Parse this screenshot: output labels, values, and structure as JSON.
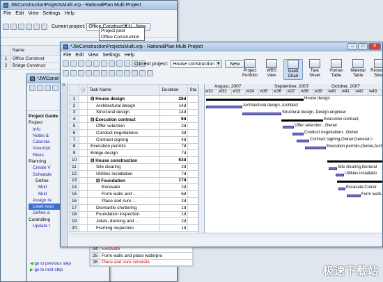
{
  "back_window": {
    "title": "JWConstructionProjectsMulti.xrp - RationalPlan Multi Project",
    "menu": [
      "File",
      "Edit",
      "View",
      "Settings",
      "Help"
    ],
    "current_project_label": "Current project:",
    "current_project_value": "Office Construction",
    "dropdown_options": [
      "Project pool",
      "Office Construction"
    ],
    "new_button": "New",
    "view_buttons": [
      "Project Portfolio",
      "WBS View",
      "Gantt Chart",
      "Task Sheet",
      "Human Table",
      "Material Table",
      "Resource Sheet"
    ],
    "name_header": "Name",
    "rows": [
      {
        "n": "1",
        "name": "Office Construct"
      },
      {
        "n": "2",
        "name": "Bridge Construct"
      }
    ]
  },
  "middle_window": {
    "title": "*JWConst",
    "panel_title": "Project Guide",
    "guide_items": [
      "Project",
      "Info",
      "Notes &",
      "Calenda",
      "Assumpt",
      "Risks",
      "Planning",
      "Create V",
      "Schedule",
      "Define",
      "Mult",
      "Mult",
      "Assign re",
      "Level reso",
      "Define a",
      "Controlling",
      "Update t"
    ],
    "prev_step": "go to previous step",
    "next_step": "go to next step",
    "bottom_rows": [
      {
        "n": "24",
        "name": "Excavate"
      },
      {
        "n": "25",
        "name": "Form walls and place waterpro"
      },
      {
        "n": "26",
        "name": "Place and cure concrete"
      }
    ]
  },
  "front_window": {
    "title": "*JWConstructionProjectsMulti.xrp - RationalPlan Multi Project",
    "menu": [
      "File",
      "Edit",
      "View",
      "Settings",
      "Help"
    ],
    "current_project_label": "Current project:",
    "current_project_value": "House construction",
    "new_button": "New",
    "view_buttons": [
      "Project Portfolio",
      "WBS View",
      "Gantt Chart",
      "Task Sheet",
      "Human Table",
      "Material Table",
      "Resource Sheet"
    ],
    "col_task": "Task Name",
    "col_duration": "Duration",
    "col_start": "Sta",
    "tasks": [
      {
        "n": "1",
        "name": "House design",
        "dur": "28d",
        "bold": true,
        "indent": 0,
        "sum": true
      },
      {
        "n": "2",
        "name": "Architectural design",
        "dur": "14d",
        "bold": false,
        "indent": 1
      },
      {
        "n": "3",
        "name": "Structural design",
        "dur": "14d",
        "bold": false,
        "indent": 1
      },
      {
        "n": "4",
        "name": "Execution contract",
        "dur": "9d",
        "bold": true,
        "indent": 0,
        "sum": true
      },
      {
        "n": "5",
        "name": "Offer selection",
        "dur": "2d",
        "bold": false,
        "indent": 1
      },
      {
        "n": "6",
        "name": "Conduct negotiations",
        "dur": "3d",
        "bold": false,
        "indent": 1
      },
      {
        "n": "7",
        "name": "Contract signing",
        "dur": "4d",
        "bold": false,
        "indent": 1
      },
      {
        "n": "8",
        "name": "Execution permits",
        "dur": "7d",
        "bold": false,
        "indent": 0
      },
      {
        "n": "9",
        "name": "Bridge design",
        "dur": "7d",
        "bold": false,
        "indent": 0
      },
      {
        "n": "10",
        "name": "House construction",
        "dur": "63d",
        "bold": true,
        "indent": 0,
        "sum": true
      },
      {
        "n": "11",
        "name": "Site clearing",
        "dur": "2d",
        "bold": false,
        "indent": 1
      },
      {
        "n": "12",
        "name": "Utilities installation",
        "dur": "7d",
        "bold": false,
        "indent": 1
      },
      {
        "n": "13",
        "name": "Foundation",
        "dur": "17d",
        "bold": true,
        "indent": 1,
        "sum": true
      },
      {
        "n": "14",
        "name": "Excavate",
        "dur": "2d",
        "bold": false,
        "indent": 2
      },
      {
        "n": "15",
        "name": "Form walls and ...",
        "dur": "6d",
        "bold": false,
        "indent": 2
      },
      {
        "n": "16",
        "name": "Place and cure ...",
        "dur": "2d",
        "bold": false,
        "indent": 2
      },
      {
        "n": "17",
        "name": "Dismantle shuttering",
        "dur": "1d",
        "bold": false,
        "indent": 1
      },
      {
        "n": "18",
        "name": "Foundation inspection",
        "dur": "1d",
        "bold": false,
        "indent": 1
      },
      {
        "n": "19",
        "name": "Joists, decking and ...",
        "dur": "2d",
        "bold": false,
        "indent": 1
      },
      {
        "n": "20",
        "name": "Framing inspection",
        "dur": "1d",
        "bold": false,
        "indent": 1
      }
    ],
    "months": [
      "August, 2007",
      "September, 2007",
      "October, 2007"
    ],
    "weeks": [
      "w31",
      "w32",
      "w33",
      "w34",
      "w35",
      "w36",
      "w37",
      "w38",
      "w39",
      "w40",
      "w41",
      "w42",
      "w43"
    ],
    "gantt_labels": [
      "House design",
      "Architectural design, Architect",
      "Structural design, Design engineer",
      "Execution contract,",
      "Offer selection , Owner",
      "Conduct negotiations ,Owner",
      "Contract signing,Owner,General c",
      "Execution permits,Owner,Archi",
      "",
      "",
      "Site clearing,General",
      "Utilities installatio",
      "Foundation",
      "Excavate,Constr",
      "Form walls a"
    ]
  },
  "watermark": "极速下载站"
}
